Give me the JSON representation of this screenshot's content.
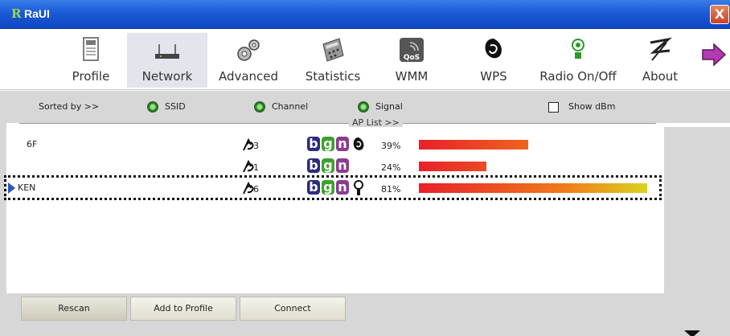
{
  "window": {
    "title": "RaUI",
    "logo_glyph": "R",
    "close_label": "X"
  },
  "toolbar": {
    "items": [
      {
        "label": "Profile",
        "icon": "profile-icon"
      },
      {
        "label": "Network",
        "icon": "network-icon",
        "selected": true
      },
      {
        "label": "Advanced",
        "icon": "gears-icon"
      },
      {
        "label": "Statistics",
        "icon": "calculator-icon"
      },
      {
        "label": "WMM",
        "icon": "wmm-qos-icon"
      },
      {
        "label": "WPS",
        "icon": "wps-icon"
      },
      {
        "label": "Radio On/Off",
        "icon": "radio-icon"
      },
      {
        "label": "About",
        "icon": "about-icon"
      }
    ],
    "next_icon": "next-arrow-icon",
    "wmm_icon_text": "QoS"
  },
  "options": {
    "sorted_by": "Sorted by >>",
    "ssid": "SSID",
    "channel": "Channel",
    "signal": "Signal",
    "show_dbm": "Show dBm",
    "ap_list": "AP List >>"
  },
  "ap_list": [
    {
      "ssid": "6F",
      "channel": "3",
      "modes": [
        "b",
        "g",
        "n"
      ],
      "extra": "wps-icon",
      "signal_pct": 39,
      "signal_label": "39%",
      "selected": false
    },
    {
      "ssid": "",
      "channel": "1",
      "modes": [
        "b",
        "g",
        "n"
      ],
      "extra": "",
      "signal_pct": 24,
      "signal_label": "24%",
      "selected": false
    },
    {
      "ssid": "KEN",
      "channel": "6",
      "modes": [
        "b",
        "g",
        "n"
      ],
      "extra": "key-icon",
      "signal_pct": 81,
      "signal_label": "81%",
      "selected": true
    }
  ],
  "buttons": {
    "rescan": "Rescan",
    "add_to_profile": "Add to Profile",
    "connect": "Connect"
  },
  "colors": {
    "titlebar": "#1b5bd6",
    "panel": "#d7d7d7",
    "selected_tab": "#e4e4ec"
  }
}
